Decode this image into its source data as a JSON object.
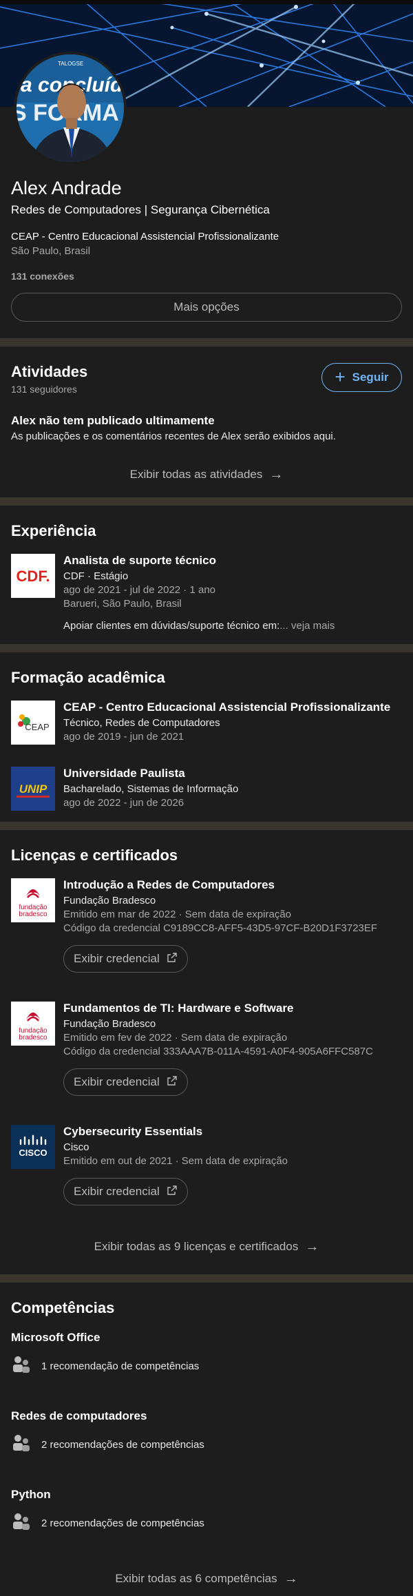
{
  "profile": {
    "name": "Alex Andrade",
    "headline": "Redes de Computadores | Segurança Cibernética",
    "school": "CEAP - Centro Educacional Assistencial Profissionalizante",
    "location": "São Paulo, Brasil",
    "connections": "131 conexões",
    "more_button": "Mais opções",
    "avatar_banner_text1": "a concluído!",
    "avatar_banner_text2": "S FORMA",
    "avatar_banner_text3": "TALOGSE"
  },
  "activity": {
    "title": "Atividades",
    "followers": "131 seguidores",
    "follow_button": "Seguir",
    "empty_title": "Alex não tem publicado ultimamente",
    "empty_subtitle": "As publicações e os comentários recentes de Alex serão exibidos aqui.",
    "show_all": "Exibir todas as atividades"
  },
  "experience": {
    "title": "Experiência",
    "items": [
      {
        "logo_text": "CDF.",
        "role": "Analista de suporte técnico",
        "company": "CDF · Estágio",
        "dates": "ago de 2021 - jul de 2022 · 1 ano",
        "location": "Barueri, São Paulo, Brasil",
        "description": "Apoiar clientes em dúvidas/suporte técnico em:",
        "see_more": "... veja mais"
      }
    ]
  },
  "education": {
    "title": "Formação acadêmica",
    "items": [
      {
        "logo_text": "CEAP",
        "school": "CEAP - Centro Educacional Assistencial Profissionalizante",
        "degree": "Técnico, Redes de Computadores",
        "dates": "ago de 2019 - jun de 2021"
      },
      {
        "logo_text": "UNIP",
        "school": "Universidade Paulista",
        "degree": "Bacharelado, Sistemas de Informação",
        "dates": "ago de 2022 - jun de 2026"
      }
    ]
  },
  "licenses": {
    "title": "Licenças e certificados",
    "items": [
      {
        "logo": "fundacao-bradesco",
        "logo_text1": "fundação",
        "logo_text2": "bradesco",
        "name": "Introdução a Redes de Computadores",
        "issuer": "Fundação Bradesco",
        "issued": "Emitido em mar de 2022 · Sem data de expiração",
        "credential": "Código da credencial C9189CC8-AFF5-43D5-97CF-B20D1F3723EF",
        "button": "Exibir credencial"
      },
      {
        "logo": "fundacao-bradesco",
        "logo_text1": "fundação",
        "logo_text2": "bradesco",
        "name": "Fundamentos de TI: Hardware e Software",
        "issuer": "Fundação Bradesco",
        "issued": "Emitido em fev de 2022 · Sem data de expiração",
        "credential": "Código da credencial 333AAA7B-011A-4591-A0F4-905A6FFC587C",
        "button": "Exibir credencial"
      },
      {
        "logo": "cisco",
        "logo_text": "CISCO",
        "name": "Cybersecurity Essentials",
        "issuer": "Cisco",
        "issued": "Emitido em out de 2021 · Sem data de expiração",
        "button": "Exibir credencial"
      }
    ],
    "show_all": "Exibir todas as 9 licenças e certificados"
  },
  "skills": {
    "title": "Competências",
    "items": [
      {
        "name": "Microsoft Office",
        "endorsements": "1 recomendação de competências"
      },
      {
        "name": "Redes de computadores",
        "endorsements": "2 recomendações de competências"
      },
      {
        "name": "Python",
        "endorsements": "2 recomendações de competências"
      }
    ],
    "show_all": "Exibir todas as 6 competências"
  },
  "colors": {
    "background": "#1d1d1d",
    "divider": "#38342e",
    "accent_blue": "#70b5f9",
    "cdf_red": "#e2231a",
    "bradesco_red": "#cc092f",
    "cisco_navy": "#0a3057"
  }
}
